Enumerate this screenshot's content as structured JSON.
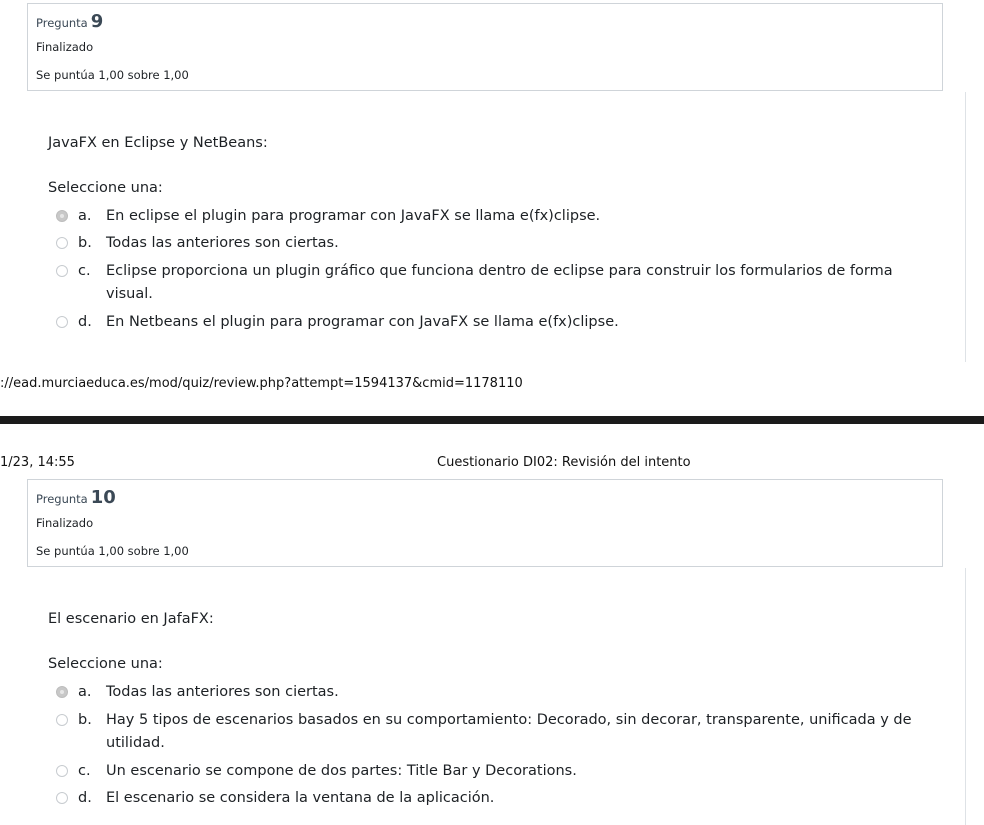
{
  "page_top": {
    "question": {
      "label": "Pregunta",
      "number": "9",
      "state": "Finalizado",
      "grade": "Se puntúa 1,00 sobre 1,00",
      "text": "JavaFX en Eclipse y NetBeans:",
      "prompt": "Seleccione una:",
      "selected": "a",
      "options": [
        {
          "letter": "a.",
          "text": "En eclipse el plugin para programar con JavaFX se llama e(fx)clipse."
        },
        {
          "letter": "b.",
          "text": "Todas las anteriores son ciertas."
        },
        {
          "letter": "c.",
          "text": "Eclipse proporciona un plugin gráfico que funciona dentro de eclipse para construir los formularios de forma visual."
        },
        {
          "letter": "d.",
          "text": "En Netbeans el plugin para programar con JavaFX se llama e(fx)clipse."
        }
      ]
    },
    "footer_url": "://ead.murciaeduca.es/mod/quiz/review.php?attempt=1594137&cmid=1178110"
  },
  "page_bottom": {
    "header": {
      "date": "1/23, 14:55",
      "title": "Cuestionario DI02: Revisión del intento"
    },
    "question": {
      "label": "Pregunta",
      "number": "10",
      "state": "Finalizado",
      "grade": "Se puntúa 1,00 sobre 1,00",
      "text": "El escenario en JafaFX:",
      "prompt": "Seleccione una:",
      "selected": "a",
      "options": [
        {
          "letter": "a.",
          "text": "Todas las anteriores son ciertas."
        },
        {
          "letter": "b.",
          "text": "Hay 5 tipos de escenarios basados en su comportamiento: Decorado, sin decorar, transparente, unificada y de utilidad."
        },
        {
          "letter": "c.",
          "text": "Un escenario se compone de dos partes: Title Bar y Decorations."
        },
        {
          "letter": "d.",
          "text": "El escenario se considera la ventana de la aplicación."
        }
      ]
    }
  }
}
